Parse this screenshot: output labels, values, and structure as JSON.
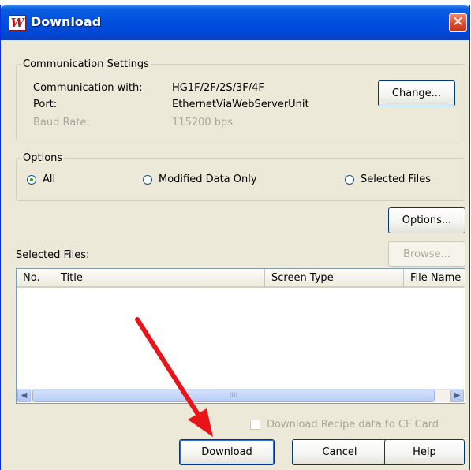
{
  "window": {
    "title": "Download",
    "icon_glyph": "W",
    "close_glyph": "✕"
  },
  "comm": {
    "legend": "Communication Settings",
    "with_label": "Communication with:",
    "with_value": "HG1F/2F/2S/3F/4F",
    "port_label": "Port:",
    "port_value": "EthernetViaWebServerUnit",
    "baud_label": "Baud Rate:",
    "baud_value": "115200 bps",
    "change_button": "Change..."
  },
  "options": {
    "legend": "Options",
    "radio_all": "All",
    "radio_modified": "Modified Data Only",
    "radio_selected": "Selected Files",
    "selected": "All",
    "options_button": "Options..."
  },
  "files": {
    "label": "Selected Files:",
    "browse_button": "Browse...",
    "columns": [
      "No.",
      "Title",
      "Screen Type",
      "File Name"
    ],
    "scroll_grip": "IIII"
  },
  "recipe_checkbox_label": "Download Recipe data to CF Card",
  "buttons": {
    "download": "Download",
    "cancel": "Cancel",
    "help": "Help"
  },
  "colors": {
    "titlebar": "#0050e0",
    "dialog_bg": "#ece9d8",
    "annotation_arrow": "#e8141a"
  },
  "icons": [
    "app-w-icon",
    "close-icon",
    "scroll-left-arrow-icon",
    "scroll-right-arrow-icon",
    "annotation-arrow"
  ]
}
